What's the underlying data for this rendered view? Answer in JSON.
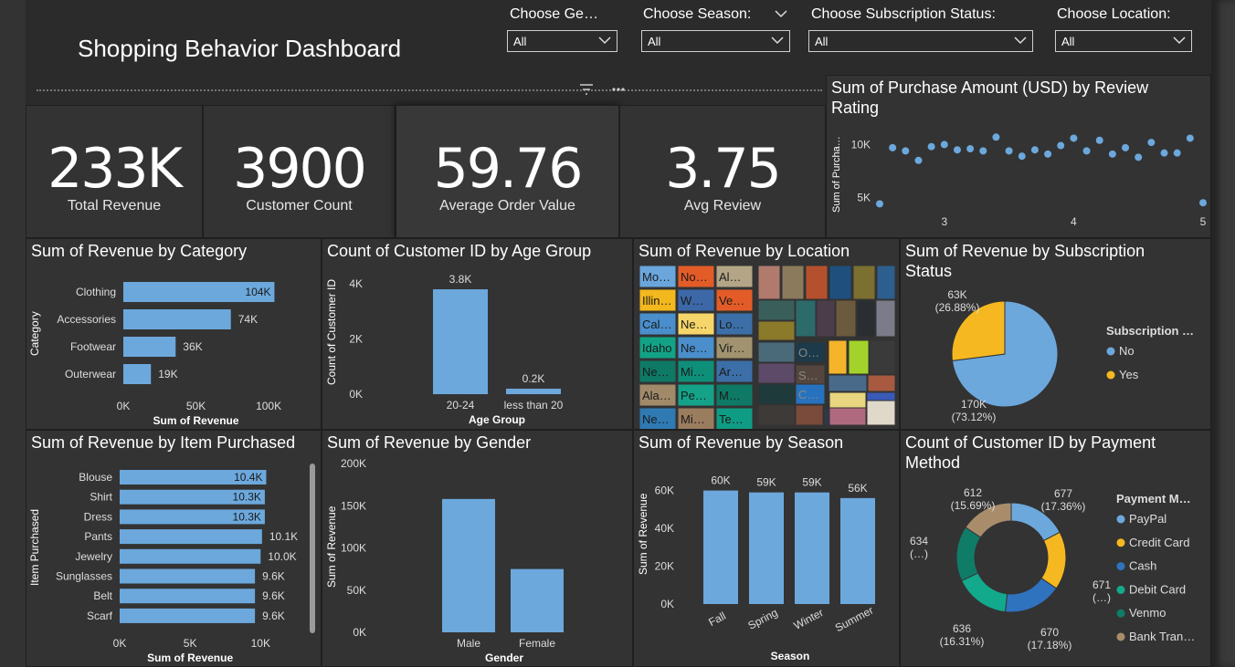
{
  "dashboard": {
    "title": "Shopping Behavior Dashboard",
    "accent": "#6ca8dc",
    "secondary": "#f6b820",
    "filter_icon": "filter-icon",
    "more_icon": "more-options-icon"
  },
  "slicers": [
    {
      "label": "Choose Ge…",
      "value": "All"
    },
    {
      "label": "Choose Season:",
      "value": "All"
    },
    {
      "label": "Choose Subscription Status:",
      "value": "All"
    },
    {
      "label": "Choose Location:",
      "value": "All"
    }
  ],
  "kpis": [
    {
      "value": "233K",
      "label": "Total Revenue"
    },
    {
      "value": "3900",
      "label": "Customer Count"
    },
    {
      "value": "59.76",
      "label": "Average Order Value"
    },
    {
      "value": "3.75",
      "label": "Avg Review"
    }
  ],
  "panels": {
    "review": "Sum of Purchase Amount (USD) by Review Rating",
    "category": "Sum of Revenue by Category",
    "age": "Count of Customer ID by Age Group",
    "location": "Sum of Revenue by Location",
    "subscription": "Sum of Revenue by Subscription Status",
    "item": "Sum of Revenue by Item Purchased",
    "gender": "Sum of Revenue by Gender",
    "season": "Sum of Revenue by Season",
    "payment": "Count of Customer ID by Payment Method"
  },
  "chart_data": [
    {
      "id": "review",
      "type": "scatter",
      "title": "Sum of Purchase Amount (USD) by Review Rating",
      "ylabel": "Sum of Purcha…",
      "xticks": [
        "3",
        "4",
        "5"
      ],
      "yticks": [
        "5K",
        "10K"
      ],
      "xlim": [
        2.5,
        5.0
      ],
      "ylim": [
        4000,
        11500
      ],
      "x": [
        2.5,
        2.6,
        2.7,
        2.8,
        2.9,
        3.0,
        3.1,
        3.2,
        3.3,
        3.4,
        3.5,
        3.6,
        3.7,
        3.8,
        3.9,
        4.0,
        4.1,
        4.2,
        4.3,
        4.4,
        4.5,
        4.6,
        4.7,
        4.8,
        4.9,
        5.0
      ],
      "y": [
        4400,
        9700,
        9400,
        8500,
        9800,
        10000,
        9500,
        9600,
        9400,
        10700,
        9400,
        8900,
        9500,
        9100,
        9900,
        10600,
        9400,
        10400,
        9100,
        9700,
        8800,
        10200,
        9200,
        9200,
        10600,
        4500
      ]
    },
    {
      "id": "category",
      "type": "bar",
      "orientation": "horizontal",
      "title": "Sum of Revenue by Category",
      "categories": [
        "Clothing",
        "Accessories",
        "Footwear",
        "Outerwear"
      ],
      "values": [
        104000,
        74000,
        36000,
        19000
      ],
      "labels": [
        "104K",
        "74K",
        "36K",
        "19K"
      ],
      "xlabel": "Sum of Revenue",
      "ylabel": "Category",
      "xticks": [
        "0K",
        "50K",
        "100K"
      ],
      "xlim": [
        0,
        110000
      ]
    },
    {
      "id": "age",
      "type": "bar",
      "title": "Count of Customer ID by Age Group",
      "categories": [
        "20-24",
        "less than 20"
      ],
      "values": [
        3800,
        200
      ],
      "labels": [
        "3.8K",
        "0.2K"
      ],
      "xlabel": "Age Group",
      "ylabel": "Count of Customer ID",
      "yticks": [
        "0K",
        "2K",
        "4K"
      ],
      "ylim": [
        0,
        4000
      ]
    },
    {
      "id": "location",
      "type": "heatmap",
      "title": "Sum of Revenue by Location",
      "tiles": [
        {
          "label": "Mo…",
          "color": "#6aa6dc"
        },
        {
          "label": "No…",
          "color": "#e35c28"
        },
        {
          "label": "Al…",
          "color": "#b4a586"
        },
        {
          "label": "Illin…",
          "color": "#f3b81d"
        },
        {
          "label": "W…",
          "color": "#3d68a8"
        },
        {
          "label": "Ve…",
          "color": "#e35c28"
        },
        {
          "label": "Cal…",
          "color": "#4a8fcc"
        },
        {
          "label": "Ne…",
          "color": "#f6d66a"
        },
        {
          "label": "Lo…",
          "color": "#3c6fa8"
        },
        {
          "label": "Idaho",
          "color": "#12a386"
        },
        {
          "label": "Ne…",
          "color": "#4a8fcc"
        },
        {
          "label": "Vir…",
          "color": "#a1936f"
        },
        {
          "label": "Ne…",
          "color": "#0e7a66"
        },
        {
          "label": "Mi…",
          "color": "#0e8f7a"
        },
        {
          "label": "Ar…",
          "color": "#3c6fa8"
        },
        {
          "label": "Ala…",
          "color": "#a18a6a"
        },
        {
          "label": "Pe…",
          "color": "#14a389"
        },
        {
          "label": "M…",
          "color": "#0e7a66"
        },
        {
          "label": "Ne…",
          "color": "#2f7ab3"
        },
        {
          "label": "Mi…",
          "color": "#9a7c5e"
        },
        {
          "label": "Te…",
          "color": "#0f9c84"
        },
        {
          "label": "O…",
          "color": "#1c3a4a"
        },
        {
          "label": "S…",
          "color": "#54463e"
        },
        {
          "label": "C…",
          "color": "#2772be"
        }
      ]
    },
    {
      "id": "subscription",
      "type": "pie",
      "title": "Sum of Revenue by Subscription Status",
      "legend_title": "Subscription …",
      "slices": [
        {
          "name": "No",
          "value": 170000,
          "label": "170K",
          "pct": "(73.12%)",
          "color": "#6ca8dc"
        },
        {
          "name": "Yes",
          "value": 63000,
          "label": "63K",
          "pct": "(26.88%)",
          "color": "#f6b820"
        }
      ]
    },
    {
      "id": "item",
      "type": "bar",
      "orientation": "horizontal",
      "title": "Sum of Revenue by Item Purchased",
      "categories": [
        "Blouse",
        "Shirt",
        "Dress",
        "Pants",
        "Jewelry",
        "Sunglasses",
        "Belt",
        "Scarf"
      ],
      "values": [
        10400,
        10300,
        10300,
        10100,
        10000,
        9600,
        9600,
        9600
      ],
      "labels": [
        "10.4K",
        "10.3K",
        "10.3K",
        "10.1K",
        "10.0K",
        "9.6K",
        "9.6K",
        "9.6K"
      ],
      "xlabel": "Sum of Revenue",
      "ylabel": "Item Purchased",
      "xticks": [
        "0K",
        "5K",
        "10K"
      ],
      "xlim": [
        0,
        10500
      ]
    },
    {
      "id": "gender",
      "type": "bar",
      "title": "Sum of Revenue by Gender",
      "categories": [
        "Male",
        "Female"
      ],
      "values": [
        158000,
        75000
      ],
      "xlabel": "Gender",
      "ylabel": "Sum of Revenue",
      "yticks": [
        "0K",
        "50K",
        "100K",
        "150K",
        "200K"
      ],
      "ylim": [
        0,
        200000
      ]
    },
    {
      "id": "season",
      "type": "bar",
      "title": "Sum of Revenue by Season",
      "categories": [
        "Fall",
        "Spring",
        "Winter",
        "Summer"
      ],
      "values": [
        60000,
        59000,
        59000,
        56000
      ],
      "labels": [
        "60K",
        "59K",
        "59K",
        "56K"
      ],
      "xlabel": "Season",
      "ylabel": "Sum of Revenue",
      "yticks": [
        "0K",
        "20K",
        "40K",
        "60K"
      ],
      "ylim": [
        0,
        68000
      ]
    },
    {
      "id": "payment",
      "type": "pie",
      "title": "Count of Customer ID by Payment Method",
      "legend_title": "Payment M…",
      "slices": [
        {
          "name": "PayPal",
          "value": 677,
          "label": "677",
          "pct": "(17.36%)",
          "color": "#6ca8dc"
        },
        {
          "name": "Credit Card",
          "value": 671,
          "label": "671",
          "pct": "(…)",
          "color": "#f6b820"
        },
        {
          "name": "Cash",
          "value": 670,
          "label": "670",
          "pct": "(17.18%)",
          "color": "#2f72be"
        },
        {
          "name": "Debit Card",
          "value": 636,
          "label": "636",
          "pct": "(16.31%)",
          "color": "#13a98c"
        },
        {
          "name": "Venmo",
          "value": 634,
          "label": "634",
          "pct": "(…)",
          "color": "#0f7c68"
        },
        {
          "name": "Bank Tran…",
          "value": 612,
          "label": "612",
          "pct": "(15.69%)",
          "color": "#a98d6b"
        }
      ]
    }
  ]
}
